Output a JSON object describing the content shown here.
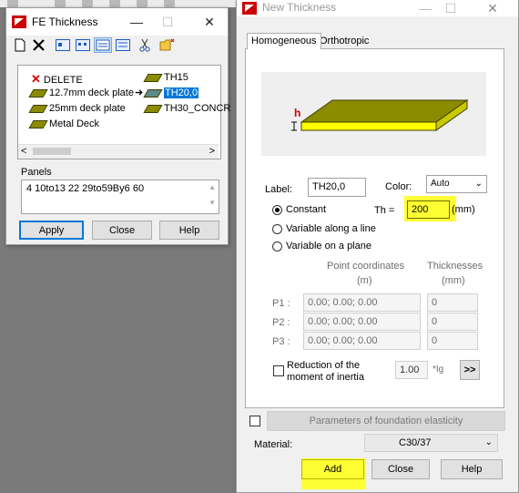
{
  "fe_thickness": {
    "title": "FE Thickness",
    "tb_min": "—",
    "tb_max": "☐",
    "tb_close": "✕",
    "list_items": [
      {
        "label": "DELETE"
      },
      {
        "label": "TH15"
      },
      {
        "label": "12.7mm deck plate"
      },
      {
        "label": "TH20,0"
      },
      {
        "label": "25mm deck plate"
      },
      {
        "label": "TH30_CONCR"
      },
      {
        "label": "Metal Deck"
      }
    ],
    "arrow": "➜",
    "panels_label": "Panels",
    "panels_value": "4 10to13 22 29to59By6 60",
    "apply": "Apply",
    "close": "Close",
    "help": "Help"
  },
  "new_thickness": {
    "title": "New Thickness",
    "tb_min": "—",
    "tb_max": "☐",
    "tb_close": "✕",
    "tabs": [
      "Homogeneous",
      "Orthotropic"
    ],
    "preview_h": "h",
    "label_caption": "Label:",
    "label_value": "TH20,0",
    "color_caption": "Color:",
    "color_value": "Auto",
    "constant": "Constant",
    "th_caption": "Th =",
    "th_value": "200",
    "th_unit": "(mm)",
    "variable_line": "Variable along a line",
    "variable_plane": "Variable on a plane",
    "point_coords": "Point coordinates",
    "point_unit": "(m)",
    "thicknesses": "Thicknesses",
    "thick_unit": "(mm)",
    "p1": "P1 :",
    "p2": "P2 :",
    "p3": "P3 :",
    "p_value": "0.00; 0.00; 0.00",
    "t_value": "0",
    "reduction_line1": "Reduction of the",
    "reduction_line2": "moment of inertia",
    "reduction_value": "1.00",
    "ig_label": "*Ig",
    "more": ">>",
    "foundation": "Parameters of foundation elasticity",
    "material_caption": "Material:",
    "material_value": "C30/37",
    "add": "Add",
    "close": "Close",
    "help": "Help"
  },
  "colors": {
    "accent": "#0078d7",
    "highlight": "#ffff33",
    "plate": "#8b8b00"
  }
}
